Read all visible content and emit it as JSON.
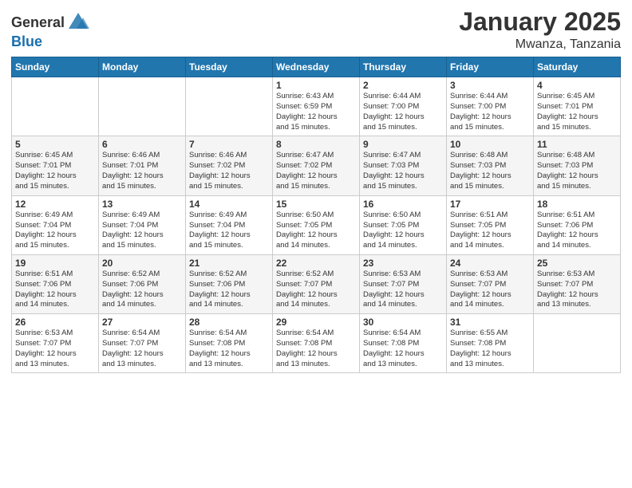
{
  "header": {
    "logo_general": "General",
    "logo_blue": "Blue",
    "month_year": "January 2025",
    "location": "Mwanza, Tanzania"
  },
  "weekdays": [
    "Sunday",
    "Monday",
    "Tuesday",
    "Wednesday",
    "Thursday",
    "Friday",
    "Saturday"
  ],
  "weeks": [
    [
      {
        "day": "",
        "info": ""
      },
      {
        "day": "",
        "info": ""
      },
      {
        "day": "",
        "info": ""
      },
      {
        "day": "1",
        "info": "Sunrise: 6:43 AM\nSunset: 6:59 PM\nDaylight: 12 hours\nand 15 minutes."
      },
      {
        "day": "2",
        "info": "Sunrise: 6:44 AM\nSunset: 7:00 PM\nDaylight: 12 hours\nand 15 minutes."
      },
      {
        "day": "3",
        "info": "Sunrise: 6:44 AM\nSunset: 7:00 PM\nDaylight: 12 hours\nand 15 minutes."
      },
      {
        "day": "4",
        "info": "Sunrise: 6:45 AM\nSunset: 7:01 PM\nDaylight: 12 hours\nand 15 minutes."
      }
    ],
    [
      {
        "day": "5",
        "info": "Sunrise: 6:45 AM\nSunset: 7:01 PM\nDaylight: 12 hours\nand 15 minutes."
      },
      {
        "day": "6",
        "info": "Sunrise: 6:46 AM\nSunset: 7:01 PM\nDaylight: 12 hours\nand 15 minutes."
      },
      {
        "day": "7",
        "info": "Sunrise: 6:46 AM\nSunset: 7:02 PM\nDaylight: 12 hours\nand 15 minutes."
      },
      {
        "day": "8",
        "info": "Sunrise: 6:47 AM\nSunset: 7:02 PM\nDaylight: 12 hours\nand 15 minutes."
      },
      {
        "day": "9",
        "info": "Sunrise: 6:47 AM\nSunset: 7:03 PM\nDaylight: 12 hours\nand 15 minutes."
      },
      {
        "day": "10",
        "info": "Sunrise: 6:48 AM\nSunset: 7:03 PM\nDaylight: 12 hours\nand 15 minutes."
      },
      {
        "day": "11",
        "info": "Sunrise: 6:48 AM\nSunset: 7:03 PM\nDaylight: 12 hours\nand 15 minutes."
      }
    ],
    [
      {
        "day": "12",
        "info": "Sunrise: 6:49 AM\nSunset: 7:04 PM\nDaylight: 12 hours\nand 15 minutes."
      },
      {
        "day": "13",
        "info": "Sunrise: 6:49 AM\nSunset: 7:04 PM\nDaylight: 12 hours\nand 15 minutes."
      },
      {
        "day": "14",
        "info": "Sunrise: 6:49 AM\nSunset: 7:04 PM\nDaylight: 12 hours\nand 15 minutes."
      },
      {
        "day": "15",
        "info": "Sunrise: 6:50 AM\nSunset: 7:05 PM\nDaylight: 12 hours\nand 14 minutes."
      },
      {
        "day": "16",
        "info": "Sunrise: 6:50 AM\nSunset: 7:05 PM\nDaylight: 12 hours\nand 14 minutes."
      },
      {
        "day": "17",
        "info": "Sunrise: 6:51 AM\nSunset: 7:05 PM\nDaylight: 12 hours\nand 14 minutes."
      },
      {
        "day": "18",
        "info": "Sunrise: 6:51 AM\nSunset: 7:06 PM\nDaylight: 12 hours\nand 14 minutes."
      }
    ],
    [
      {
        "day": "19",
        "info": "Sunrise: 6:51 AM\nSunset: 7:06 PM\nDaylight: 12 hours\nand 14 minutes."
      },
      {
        "day": "20",
        "info": "Sunrise: 6:52 AM\nSunset: 7:06 PM\nDaylight: 12 hours\nand 14 minutes."
      },
      {
        "day": "21",
        "info": "Sunrise: 6:52 AM\nSunset: 7:06 PM\nDaylight: 12 hours\nand 14 minutes."
      },
      {
        "day": "22",
        "info": "Sunrise: 6:52 AM\nSunset: 7:07 PM\nDaylight: 12 hours\nand 14 minutes."
      },
      {
        "day": "23",
        "info": "Sunrise: 6:53 AM\nSunset: 7:07 PM\nDaylight: 12 hours\nand 14 minutes."
      },
      {
        "day": "24",
        "info": "Sunrise: 6:53 AM\nSunset: 7:07 PM\nDaylight: 12 hours\nand 14 minutes."
      },
      {
        "day": "25",
        "info": "Sunrise: 6:53 AM\nSunset: 7:07 PM\nDaylight: 12 hours\nand 13 minutes."
      }
    ],
    [
      {
        "day": "26",
        "info": "Sunrise: 6:53 AM\nSunset: 7:07 PM\nDaylight: 12 hours\nand 13 minutes."
      },
      {
        "day": "27",
        "info": "Sunrise: 6:54 AM\nSunset: 7:07 PM\nDaylight: 12 hours\nand 13 minutes."
      },
      {
        "day": "28",
        "info": "Sunrise: 6:54 AM\nSunset: 7:08 PM\nDaylight: 12 hours\nand 13 minutes."
      },
      {
        "day": "29",
        "info": "Sunrise: 6:54 AM\nSunset: 7:08 PM\nDaylight: 12 hours\nand 13 minutes."
      },
      {
        "day": "30",
        "info": "Sunrise: 6:54 AM\nSunset: 7:08 PM\nDaylight: 12 hours\nand 13 minutes."
      },
      {
        "day": "31",
        "info": "Sunrise: 6:55 AM\nSunset: 7:08 PM\nDaylight: 12 hours\nand 13 minutes."
      },
      {
        "day": "",
        "info": ""
      }
    ]
  ]
}
